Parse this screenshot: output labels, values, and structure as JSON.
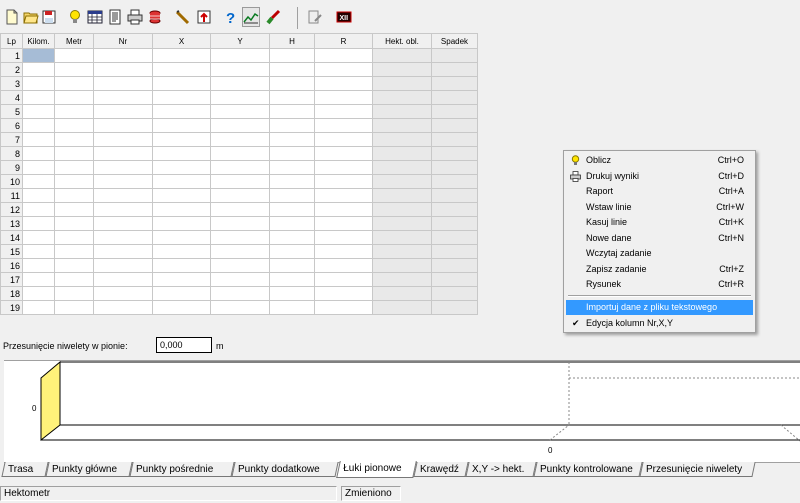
{
  "toolbar": {
    "icons": [
      "new-file-icon",
      "open-folder-icon",
      "save-icon",
      "lightbulb-icon",
      "calculator-icon",
      "report-icon",
      "print-icon",
      "coins-icon",
      "pencil-icon",
      "export-icon",
      "help-icon",
      "chart-icon",
      "brush-icon",
      "edit-document-icon",
      "close-icon"
    ]
  },
  "grid": {
    "headers": [
      "Lp",
      "Kilom.",
      "Metr",
      "Nr",
      "X",
      "Y",
      "H",
      "R",
      "Hekt. obl.",
      "Spadek"
    ],
    "rows": [
      "1",
      "2",
      "3",
      "4",
      "5",
      "6",
      "7",
      "8",
      "9",
      "10",
      "11",
      "12",
      "13",
      "14",
      "15",
      "16",
      "17",
      "18",
      "19"
    ]
  },
  "offset": {
    "label": "Przesunięcie niwelety w pionie:",
    "value": "0,000",
    "unit": "m"
  },
  "profile": {
    "y_label": "0",
    "x_label": "0"
  },
  "context_menu": {
    "items": [
      {
        "label": "Oblicz",
        "shortcut": "Ctrl+O",
        "icon": "lightbulb-icon"
      },
      {
        "label": "Drukuj wyniki",
        "shortcut": "Ctrl+D",
        "icon": "print-icon"
      },
      {
        "label": "Raport",
        "shortcut": "Ctrl+A"
      },
      {
        "label": "Wstaw linie",
        "shortcut": "Ctrl+W"
      },
      {
        "label": "Kasuj linie",
        "shortcut": "Ctrl+K"
      },
      {
        "label": "Nowe dane",
        "shortcut": "Ctrl+N"
      },
      {
        "label": "Wczytaj zadanie",
        "shortcut": ""
      },
      {
        "label": "Zapisz zadanie",
        "shortcut": "Ctrl+Z"
      },
      {
        "label": "Rysunek",
        "shortcut": "Ctrl+R"
      }
    ],
    "import_item": "Importuj dane z pliku tekstowego",
    "check_item": "Edycja kolumn Nr,X,Y",
    "check_mark": "✔"
  },
  "tabs": [
    "Trasa",
    "Punkty główne",
    "Punkty pośrednie",
    "Punkty dodatkowe",
    "Łuki pionowe",
    "Krawędź",
    "X,Y -> hekt.",
    "Punkty kontrolowane",
    "Przesunięcie niwelety"
  ],
  "active_tab": "Łuki pionowe",
  "status": {
    "left": "Hektometr",
    "right": "Zmieniono"
  },
  "colors": {
    "selection": "#3399ff",
    "cell_selected": "#a6bcd6",
    "profile_fill": "#fff27a"
  }
}
